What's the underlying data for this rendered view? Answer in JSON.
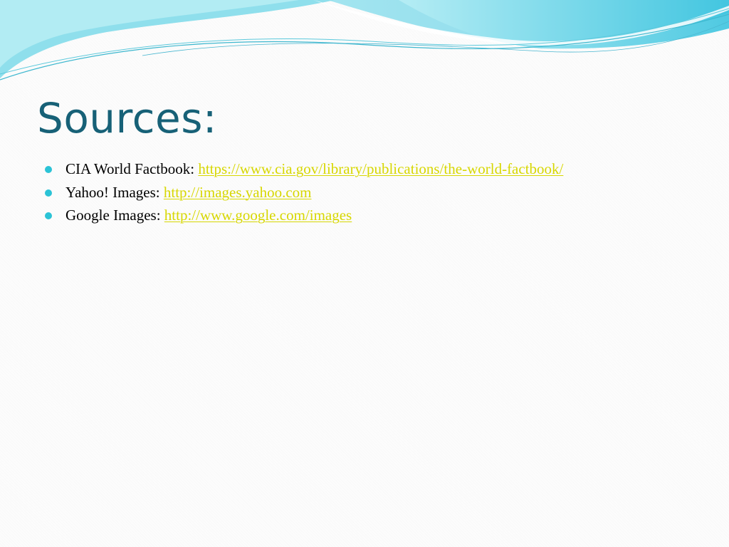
{
  "slide": {
    "title": "Sources:",
    "bullets": [
      {
        "label": "CIA World Factbook:",
        "link": "https://www.cia.gov/library/publications/the-world-factbook/"
      },
      {
        "label": "Yahoo! Images:",
        "link": "http://images.yahoo.com"
      },
      {
        "label": "Google Images:",
        "link": "http://www.google.com/images"
      }
    ]
  },
  "colors": {
    "title": "#176177",
    "bullet": "#2bc3d6",
    "link": "#d7d700",
    "wave_light": "#a9e9f1",
    "wave_mid": "#64d3e6",
    "wave_dark": "#1aa7c4"
  }
}
